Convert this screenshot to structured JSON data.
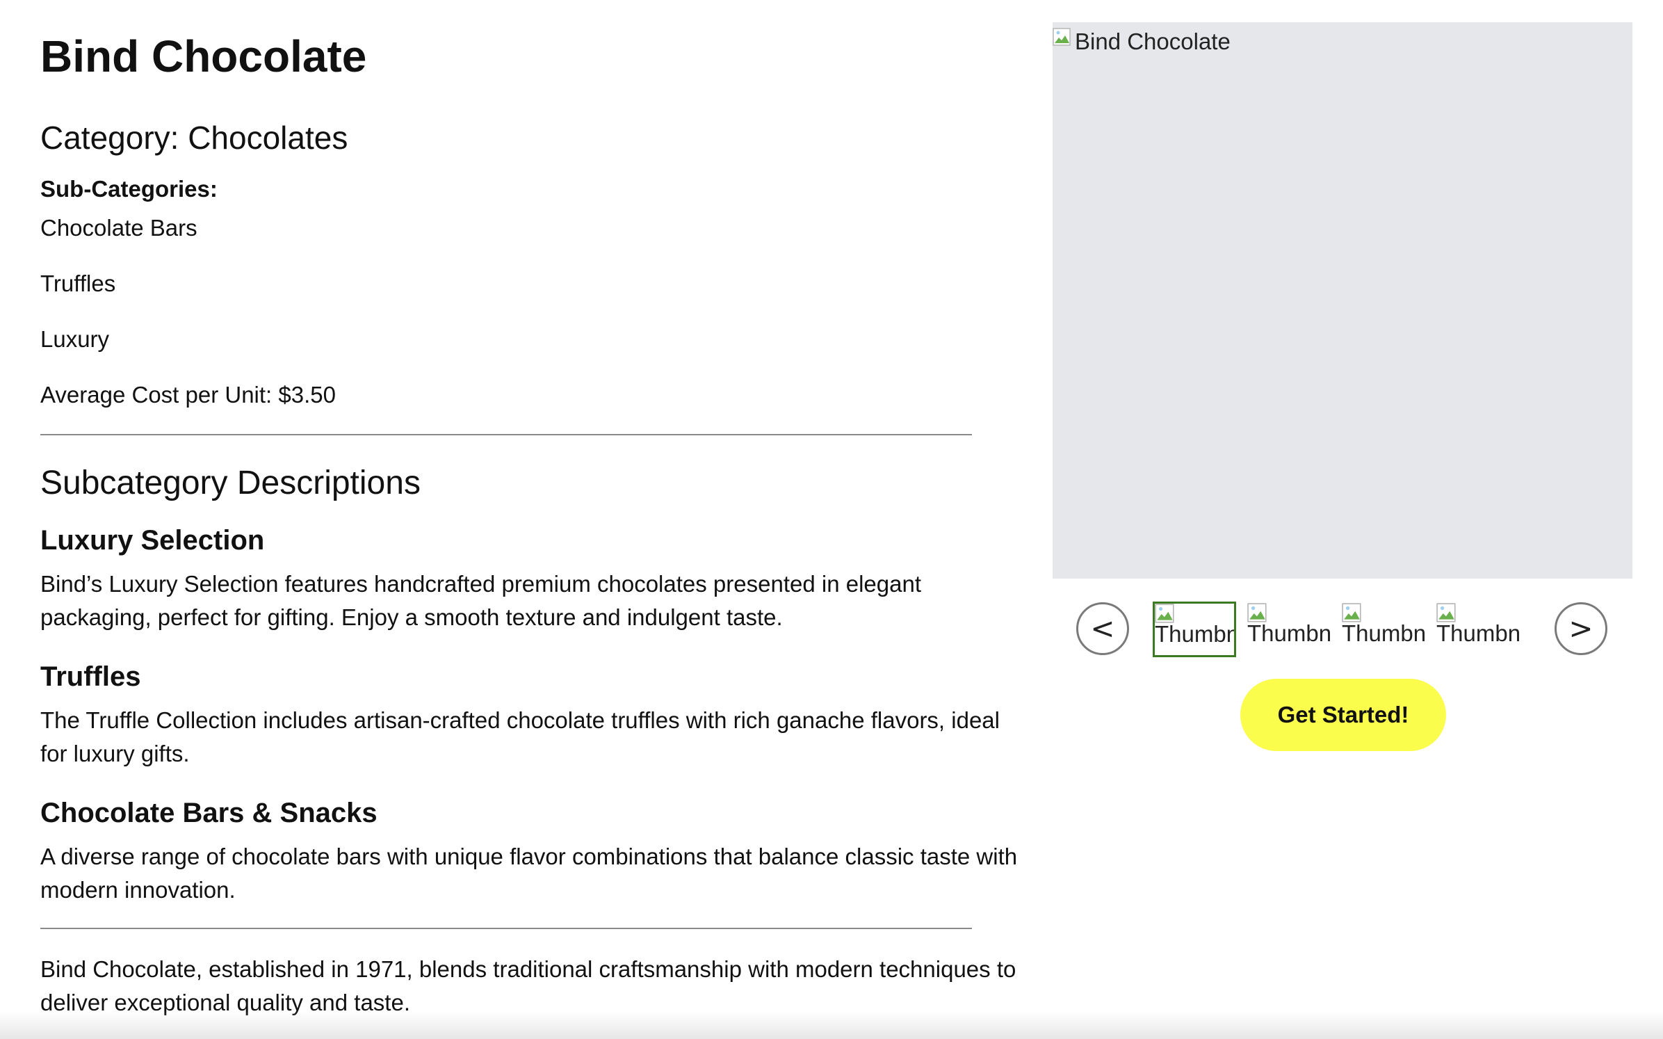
{
  "product": {
    "title": "Bind Chocolate",
    "category_line": "Category: Chocolates",
    "subcategories_heading": "Sub-Categories:",
    "subcategories": [
      "Chocolate Bars",
      "Truffles",
      "Luxury"
    ],
    "average_cost": "Average Cost per Unit: $3.50"
  },
  "descriptions": {
    "heading": "Subcategory Descriptions",
    "items": [
      {
        "title": "Luxury Selection",
        "text": "Bind’s Luxury Selection features handcrafted premium chocolates presented in elegant packaging, perfect for gifting. Enjoy a smooth texture and indulgent taste."
      },
      {
        "title": "Truffles",
        "text": "The Truffle Collection includes artisan-crafted chocolate truffles with rich ganache flavors, ideal for luxury gifts."
      },
      {
        "title": "Chocolate Bars & Snacks",
        "text": "A diverse range of chocolate bars with unique flavor combinations that balance classic taste with modern innovation."
      }
    ]
  },
  "about": {
    "text": "Bind Chocolate, established in 1971, blends traditional craftsmanship with modern techniques to deliver exceptional quality and taste."
  },
  "gallery": {
    "main_image_alt": "Bind Chocolate",
    "prev_label": "<",
    "next_label": ">",
    "thumbnails": [
      {
        "alt": "Thumbnail",
        "active": true
      },
      {
        "alt": "Thumbnail",
        "active": false
      },
      {
        "alt": "Thumbnail",
        "active": false
      },
      {
        "alt": "Thumbnail",
        "active": false
      }
    ],
    "cta_label": "Get Started!"
  },
  "colors": {
    "cta_background": "#fbfd4c",
    "image_placeholder": "#e5e7eb",
    "active_thumbnail_border": "#3b7a22"
  }
}
